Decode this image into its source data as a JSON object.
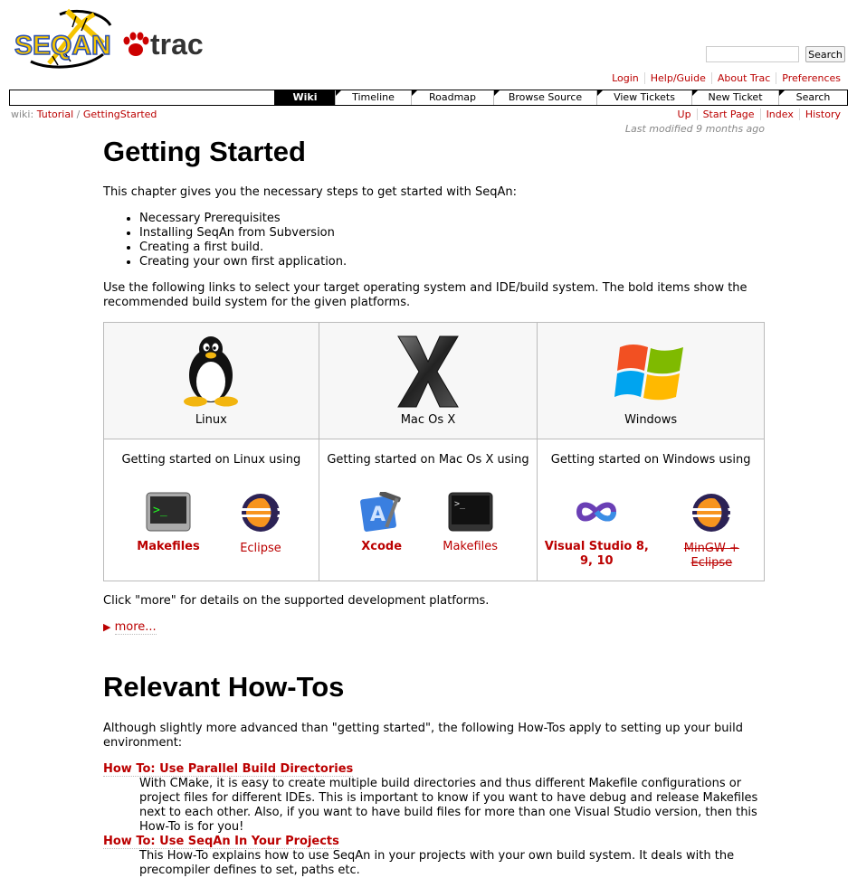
{
  "header": {
    "logo": {
      "seqan_text": "SEQAN",
      "trac_text": "trac"
    },
    "search": {
      "placeholder": "",
      "button_label": "Search"
    }
  },
  "metanav": [
    "Login",
    "Help/Guide",
    "About Trac",
    "Preferences"
  ],
  "mainnav": [
    "Wiki",
    "Timeline",
    "Roadmap",
    "Browse Source",
    "View Tickets",
    "New Ticket",
    "Search"
  ],
  "breadcrumb": {
    "prefix": "wiki:",
    "parent": "Tutorial",
    "separator": "/",
    "current": "GettingStarted"
  },
  "ctxtnav": [
    "Up",
    "Start Page",
    "Index",
    "History"
  ],
  "last_modified": "Last modified 9 months ago",
  "content": {
    "title": "Getting Started",
    "intro": "This chapter gives you the necessary steps to get started with SeqAn:",
    "steps": [
      "Necessary Prerequisites",
      "Installing SeqAn from Subversion",
      "Creating a first build.",
      "Creating your own first application."
    ],
    "platform_intro": "Use the following links to select your target operating system and IDE/build system. The bold items show the recommended build system for the given platforms.",
    "platforms": [
      {
        "name": "Linux",
        "heading": "Getting started on Linux using",
        "tools": [
          {
            "label": "Makefiles",
            "style": "bold",
            "icon": "terminal-icon"
          },
          {
            "label": "Eclipse",
            "style": "normal",
            "icon": "eclipse-icon"
          }
        ]
      },
      {
        "name": "Mac Os X",
        "heading": "Getting started on Mac Os X using",
        "tools": [
          {
            "label": "Xcode",
            "style": "bold",
            "icon": "xcode-icon"
          },
          {
            "label": "Makefiles",
            "style": "normal",
            "icon": "terminal-icon"
          }
        ]
      },
      {
        "name": "Windows",
        "heading": "Getting started on Windows using",
        "tools": [
          {
            "label": "Visual Studio 8, 9, 10",
            "style": "bold",
            "icon": "visual-studio-icon"
          },
          {
            "label": "MinGW + Eclipse",
            "style": "strike",
            "icon": "eclipse-icon"
          }
        ]
      }
    ],
    "more_note": "Click \"more\" for details on the supported development platforms.",
    "more_link": "more...",
    "howtos_title": "Relevant How-Tos",
    "howtos_intro": "Although slightly more advanced than \"getting started\", the following How-Tos apply to setting up your build environment:",
    "howtos": [
      {
        "title": "How To: Use Parallel Build Directories",
        "text": "With CMake, it is easy to create multiple build directories and thus different Makefile configurations or project files for different IDEs. This is important to know if you want to have debug and release Makefiles next to each other. Also, if you want to have build files for more than one Visual Studio version, then this How-To is for you!"
      },
      {
        "title": "How To: Use SeqAn In Your Projects",
        "text": "This How-To explains how to use SeqAn in your projects with your own build system. It deals with the precompiler defines to set, paths etc."
      }
    ]
  },
  "colors": {
    "link": "#bb0000",
    "nav_active_bg": "#000000",
    "table_border": "#bbbbbb",
    "logo_yellow": "#f5c400",
    "logo_blue": "#2a4fb0"
  }
}
